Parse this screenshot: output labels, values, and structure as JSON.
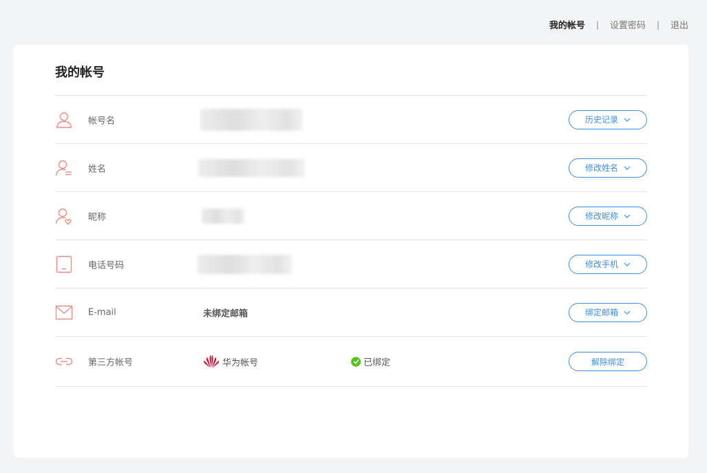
{
  "topnav": {
    "my_account": "我的帐号",
    "separator": "|",
    "set_password": "设置密码",
    "logout": "退出"
  },
  "page_title": "我的帐号",
  "rows": [
    {
      "label": "帐号名",
      "icon": "user-icon",
      "action": "历史记录",
      "has_dropdown": true
    },
    {
      "label": "姓名",
      "icon": "user-name-icon",
      "action": "修改姓名",
      "has_dropdown": true
    },
    {
      "label": "昵称",
      "icon": "user-heart-icon",
      "action": "修改昵称",
      "has_dropdown": true
    },
    {
      "label": "电话号码",
      "icon": "phone-icon",
      "action": "修改手机",
      "has_dropdown": true
    },
    {
      "label": "E-mail",
      "icon": "mail-icon",
      "value": "未绑定邮箱",
      "action": "绑定邮箱",
      "has_dropdown": true
    },
    {
      "label": "第三方帐号",
      "icon": "link-icon",
      "provider": "华为帐号",
      "status": "已绑定",
      "action": "解除绑定",
      "has_dropdown": false
    }
  ],
  "colors": {
    "accent": "#3d8ee8",
    "icon": "#f08a80",
    "success": "#52c41a",
    "huawei_red": "#cf0a2c"
  }
}
